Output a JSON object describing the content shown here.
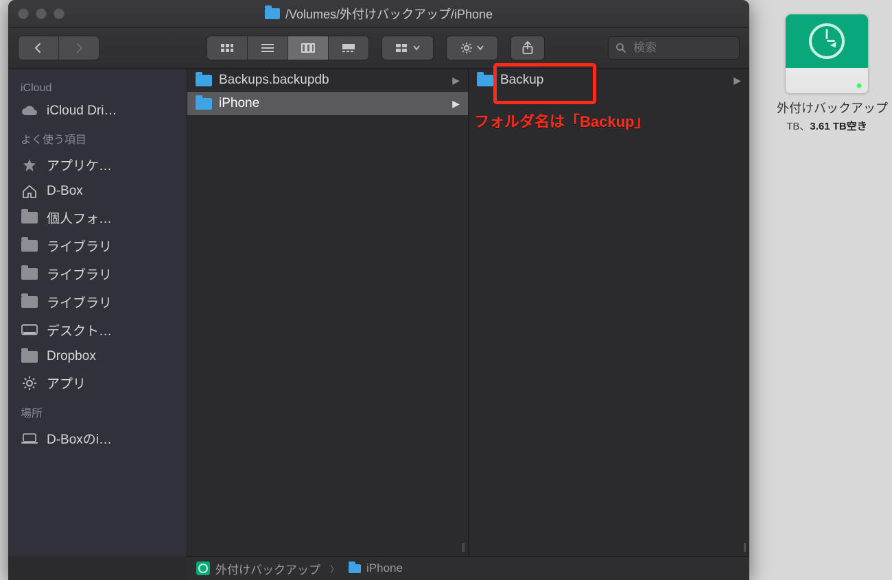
{
  "window": {
    "title": "/Volumes/外付けバックアップ/iPhone"
  },
  "search": {
    "placeholder": "検索",
    "value": ""
  },
  "sidebar": {
    "sections": [
      {
        "title": "iCloud",
        "items": [
          {
            "icon": "cloud",
            "label": "iCloud Dri…"
          }
        ]
      },
      {
        "title": "よく使う項目",
        "items": [
          {
            "icon": "appstore",
            "label": "アプリケ…"
          },
          {
            "icon": "house",
            "label": "D-Box"
          },
          {
            "icon": "folder",
            "label": "個人フォ…"
          },
          {
            "icon": "folder",
            "label": "ライブラリ"
          },
          {
            "icon": "folder",
            "label": "ライブラリ"
          },
          {
            "icon": "folder",
            "label": "ライブラリ"
          },
          {
            "icon": "desktop",
            "label": "デスクト…"
          },
          {
            "icon": "folder",
            "label": "Dropbox"
          },
          {
            "icon": "gear",
            "label": "アプリ"
          }
        ]
      },
      {
        "title": "場所",
        "items": [
          {
            "icon": "laptop",
            "label": "D-Boxのi…"
          }
        ]
      }
    ]
  },
  "columns": [
    {
      "items": [
        {
          "label": "Backups.backupdb",
          "hasChildren": true,
          "selected": false
        },
        {
          "label": "iPhone",
          "hasChildren": true,
          "selected": true
        }
      ]
    },
    {
      "items": [
        {
          "label": "Backup",
          "hasChildren": true,
          "selected": false,
          "outlined": true
        }
      ]
    }
  ],
  "annotation": {
    "text": "フォルダ名は「Backup」"
  },
  "pathbar": {
    "segments": [
      {
        "icon": "tmdrive",
        "label": "外付けバックアップ"
      },
      {
        "icon": "folder",
        "label": "iPhone"
      }
    ]
  },
  "desktop_drive": {
    "label": "外付けバックアップ",
    "storage_prefix": " TB、",
    "storage_free": "3.61 TB空き"
  }
}
